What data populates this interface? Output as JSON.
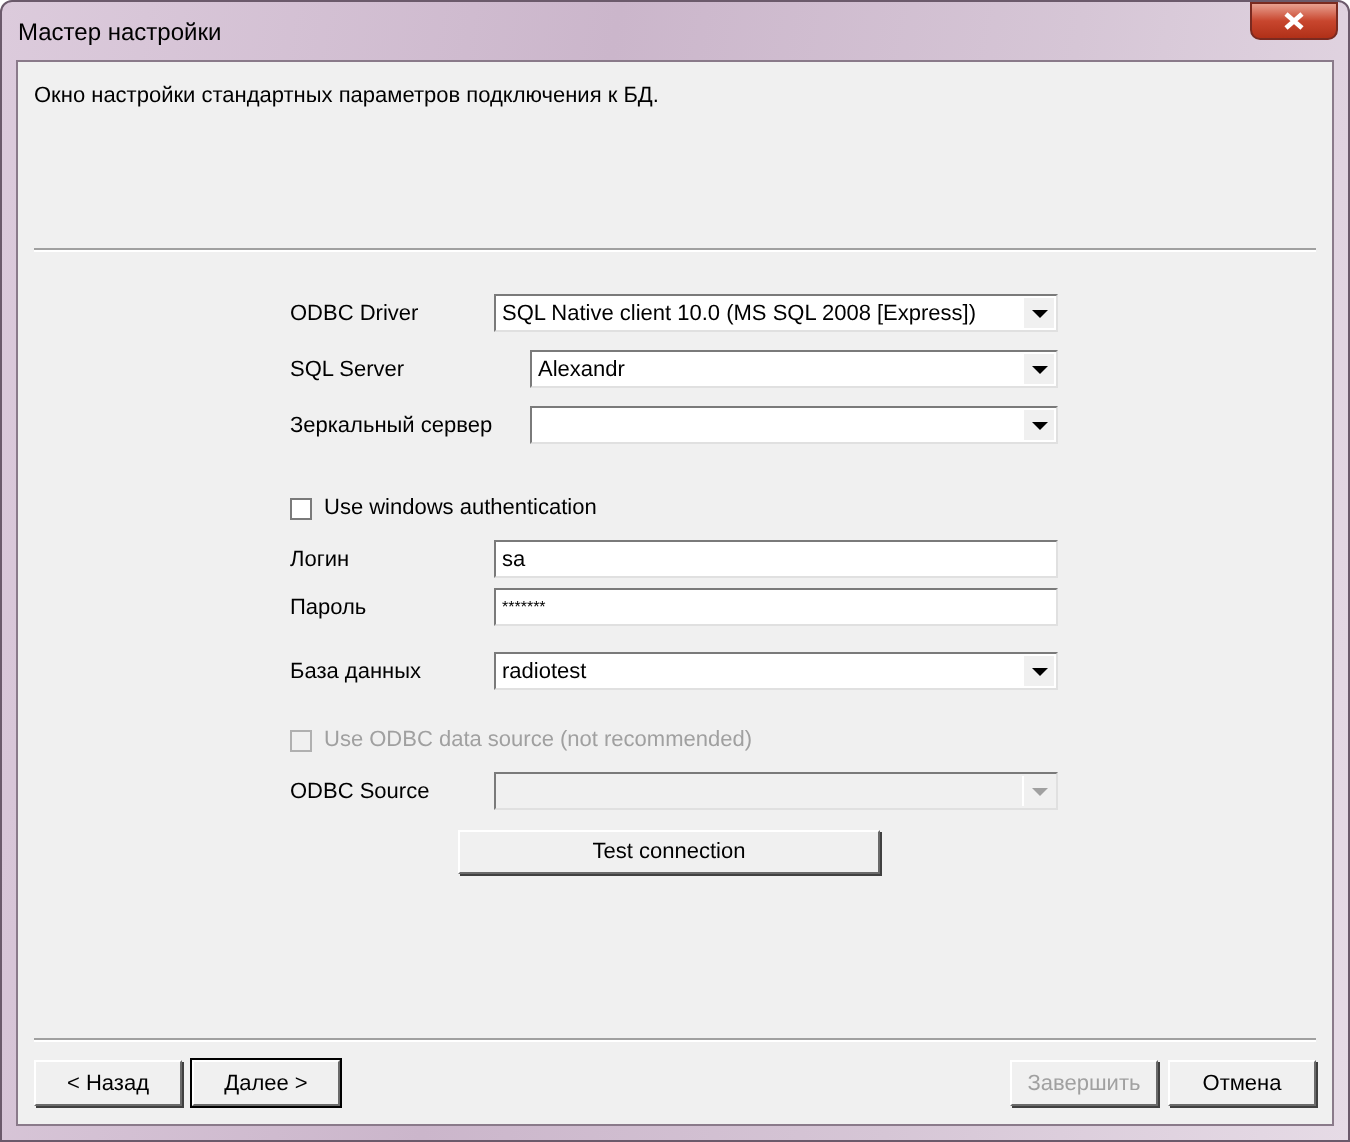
{
  "window": {
    "title": "Мастер настройки"
  },
  "description": "Окно настройки стандартных параметров подключения к БД.",
  "form": [
    {
      "kind": "combo",
      "label": "ODBC Driver",
      "value": "SQL Native client 10.0 (MS SQL 2008 [Express])",
      "disabled": false
    },
    {
      "kind": "combo",
      "label": "SQL Server",
      "value": "Alexandr",
      "disabled": false
    },
    {
      "kind": "combo",
      "label": "Зеркальный сервер",
      "disabled": false
    },
    {
      "kind": "checkbox",
      "label": "Use windows authentication",
      "checked": false,
      "disabled": false
    },
    {
      "kind": "text",
      "label": "Логин",
      "value": "sa"
    },
    {
      "kind": "password",
      "label": "Пароль",
      "value": "*******"
    },
    {
      "kind": "combo",
      "label": "База данных",
      "value": "radiotest",
      "disabled": false
    },
    {
      "kind": "checkbox",
      "label": "Use ODBC data source (not recommended)",
      "checked": false,
      "disabled": true
    },
    {
      "kind": "combo",
      "label": "ODBC Source",
      "disabled": true
    },
    {
      "kind": "button",
      "label": "Test connection",
      "disabled": false
    }
  ],
  "buttons": [
    {
      "label": "< Назад",
      "disabled": false,
      "default": false
    },
    {
      "label": "Далее >",
      "disabled": false,
      "default": true
    },
    {
      "label": "Завершить",
      "disabled": true,
      "default": false
    },
    {
      "label": "Отмена",
      "disabled": false,
      "default": false
    }
  ]
}
